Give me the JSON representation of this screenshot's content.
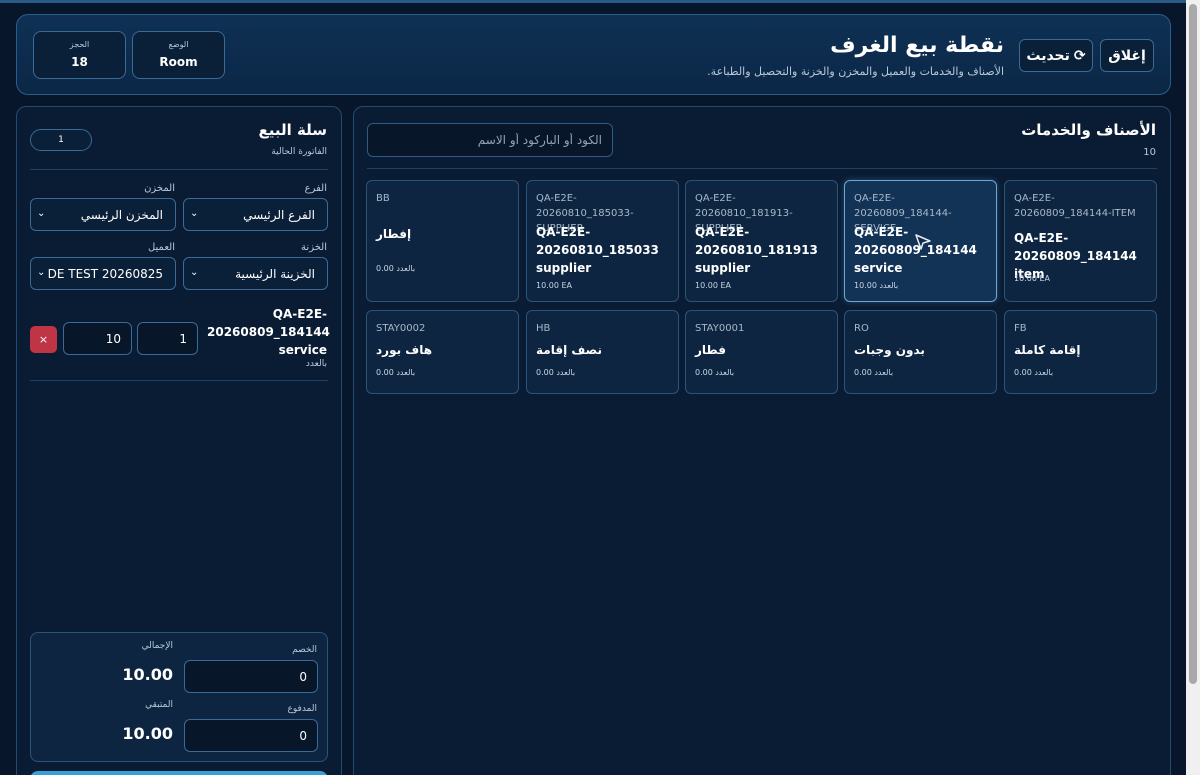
{
  "header": {
    "title": "نقطة بيع الغرف",
    "subtitle": "الأصناف والخدمات والعميل والمخزن والخزنة والتحصيل والطباعة.",
    "close_label": "إغلاق",
    "refresh_label": "تحديث",
    "refresh_icon": "⟳",
    "status": {
      "label": "الوضع",
      "value": "Room"
    },
    "rooms": {
      "label": "الحجز",
      "value": "18"
    }
  },
  "products": {
    "title": "الأصناف والخدمات",
    "count": "10",
    "search_placeholder": "الكود أو الباركود أو الاسم",
    "items": [
      {
        "code": "QA-E2E-20260809_184144-ITEM",
        "name": "QA-E2E-20260809_184144 item",
        "price": "10.00 EA"
      },
      {
        "code": "QA-E2E-20260809_184144-SERVICE",
        "name": "QA-E2E-20260809_184144 service",
        "price": "10.00 بالعدد"
      },
      {
        "code": "QA-E2E-20260810_181913-SUPPLIER",
        "name": "QA-E2E-20260810_181913 supplier",
        "price": "10.00 EA"
      },
      {
        "code": "QA-E2E-20260810_185033-SUPPLIER",
        "name": "QA-E2E-20260810_185033 supplier",
        "price": "10.00 EA"
      },
      {
        "code": "BB",
        "name": "إفطار",
        "price": "0.00 بالعدد"
      },
      {
        "code": "FB",
        "name": "إقامة كاملة",
        "price": "0.00 بالعدد"
      },
      {
        "code": "RO",
        "name": "بدون وجبات",
        "price": "0.00 بالعدد"
      },
      {
        "code": "STAY0001",
        "name": "فطار",
        "price": "0.00 بالعدد"
      },
      {
        "code": "HB",
        "name": "نصف إقامة",
        "price": "0.00 بالعدد"
      },
      {
        "code": "STAY0002",
        "name": "هاف بورد",
        "price": "0.00 بالعدد"
      }
    ]
  },
  "cart": {
    "title": "سلة البيع",
    "subtitle": "الفاتورة الحالية",
    "invoice_number": "1",
    "branch": {
      "label": "الفرع",
      "value": "الفرع الرئيسي"
    },
    "warehouse": {
      "label": "المخزن",
      "value": "المخزن الرئيسي"
    },
    "treasury": {
      "label": "الخزنة",
      "value": "الخزينة الرئيسية"
    },
    "customer": {
      "label": "العميل",
      "value": "DE TEST 20260825"
    },
    "chevron": "⌄",
    "line": {
      "name": "QA-E2E-20260809_184144 service",
      "unit": "بالعدد",
      "qty": "1",
      "price": "10",
      "remove_label": "×"
    },
    "totals": {
      "discount_label": "الخصم",
      "discount_value": "0",
      "total_label": "الإجمالي",
      "total_value": "10.00",
      "paid_label": "المدفوع",
      "paid_value": "0",
      "remaining_label": "المتبقي",
      "remaining_value": "10.00"
    }
  }
}
